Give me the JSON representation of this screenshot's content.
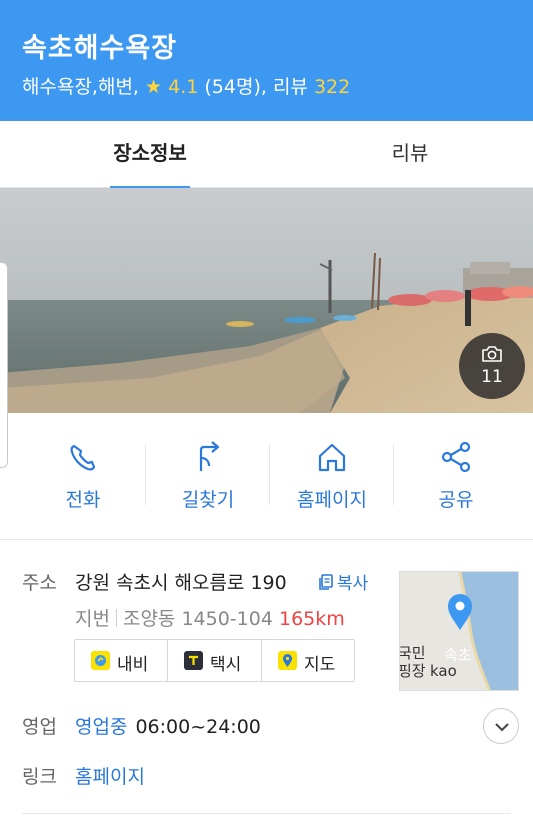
{
  "header": {
    "title": "속초해수욕장",
    "category": "해수욕장,해변,",
    "star_icon": "star-icon",
    "rating": "4.1",
    "rating_count": "(54명)",
    "review_sep": ",",
    "review_label": "리뷰",
    "review_count": "322"
  },
  "tabs": [
    {
      "label": "장소정보",
      "active": true
    },
    {
      "label": "리뷰",
      "active": false
    }
  ],
  "photo": {
    "count": "11",
    "icon": "camera-icon"
  },
  "actions": [
    {
      "label": "전화",
      "icon": "phone-icon"
    },
    {
      "label": "길찾기",
      "icon": "directions-icon"
    },
    {
      "label": "홈페이지",
      "icon": "home-icon"
    },
    {
      "label": "공유",
      "icon": "share-icon"
    }
  ],
  "info": {
    "address_label": "주소",
    "address": "강원 속초시 해오름로 190",
    "copy_label": "복사",
    "jibun_label": "지번",
    "jibun_address": "조양동 1450-104",
    "distance": "165km",
    "nav_buttons": [
      {
        "label": "내비",
        "icon": "navi-icon"
      },
      {
        "label": "택시",
        "icon": "taxi-icon"
      },
      {
        "label": "지도",
        "icon": "map-pin-icon"
      }
    ],
    "map_text_1": "국민",
    "map_text_2": "핑장",
    "map_text_3": "kao",
    "map_text_4": "속초",
    "hours_label": "영업",
    "hours_status": "영업중",
    "hours_time": "06:00~24:00",
    "link_label": "링크",
    "link_value": "홈페이지"
  },
  "colors": {
    "brand_blue": "#3c98f0",
    "link_blue": "#2a78dc",
    "star_yellow": "#ffd43b",
    "distance_red": "#ee4444",
    "kakao_yellow": "#fae100"
  }
}
